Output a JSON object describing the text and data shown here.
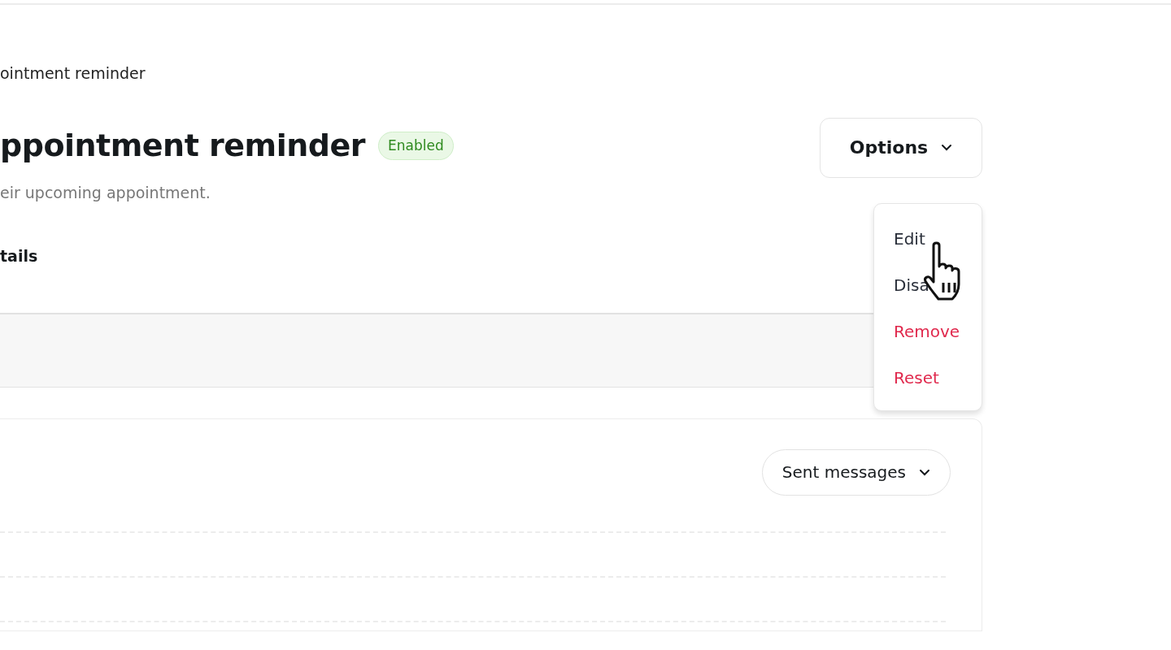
{
  "breadcrumb": "ointment reminder",
  "header": {
    "title": "ppointment reminder",
    "status": {
      "label": "Enabled",
      "enabled": true
    },
    "description": "eir upcoming appointment."
  },
  "options_button": {
    "label": "Options",
    "expanded": true
  },
  "options_menu": [
    {
      "label": "Edit",
      "kind": "default"
    },
    {
      "label": "Disa",
      "kind": "default"
    },
    {
      "label": "Remove",
      "kind": "danger"
    },
    {
      "label": "Reset",
      "kind": "danger"
    }
  ],
  "section_title": "tails",
  "chart_panel": {
    "metric_dropdown": "Sent messages"
  }
}
